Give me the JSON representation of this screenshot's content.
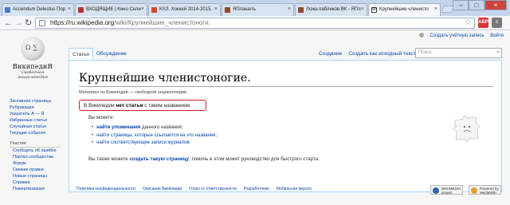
{
  "browser": {
    "tabs": [
      {
        "title": "Accendum Delectus Пор",
        "color": "#4a7cc7"
      },
      {
        "title": "ВХОДЯЩИЕ | Кино Сели",
        "color": "#b83333"
      },
      {
        "title": "КХЛ. Хоккей 2014-2015. ",
        "color": "#d44a2a"
      },
      {
        "title": "ЯПлакалъ",
        "color": "#8e4a2a"
      },
      {
        "title": "Ложа пабликов ВК - ЯПл",
        "color": "#8e4a2a"
      },
      {
        "title": "Крупнейшие членисто",
        "color": "#333333",
        "active": true
      }
    ],
    "tab_close": "×",
    "window_buttons": [
      "–",
      "□",
      "×"
    ],
    "url_host": "https://ru.wikipedia.org",
    "url_rest": "/wiki/Крупнейшие_членистоноги.",
    "nav": {
      "back": "←",
      "forward": "→",
      "reload": "↻"
    },
    "star": "☆"
  },
  "wiki": {
    "personal": {
      "create_account": "Создать учётную запись",
      "login": "Войти"
    },
    "logo": {
      "title": "ВикипедиЯ",
      "subtitle": "Свободная энциклопедия"
    },
    "sidebar": {
      "main": [
        "Заглавная страница",
        "Рубрикация",
        "Указатель А — Я",
        "Избранные статьи",
        "Случайная статья",
        "Текущие события"
      ],
      "participation_heading": "Участие",
      "participation": [
        "Сообщить об ошибке",
        "Портал сообщества",
        "Форум",
        "Свежие правки",
        "Новые страницы",
        "Справка",
        "Пожертвования"
      ]
    },
    "tabs": {
      "article": "Статья",
      "discussion": "Обсуждение",
      "create": "Создание",
      "create_source": "Создать как исходный текст"
    },
    "search_placeholder": "Поиск",
    "heading": "Крупнейшие членистоногие.",
    "tagline": "Материал из Википедии — свободной энциклопедии",
    "notice": {
      "pre": "В Википедии ",
      "bold": "нет статьи",
      "post": " с таким названием."
    },
    "you_can": "Вы можете:",
    "bullets": [
      {
        "link": "найти упоминания",
        "rest": " данного названия;"
      },
      {
        "link": "найти страницы, которые ссылаются на это название",
        "rest": ";"
      },
      {
        "link": "найти соответствующие записи журналов",
        "rest": "."
      }
    ],
    "create": {
      "pre": "Вы также можете ",
      "link": "создать такую страницу",
      "post": ", помочь в этом может руководство для быстрого старта."
    },
    "footer": [
      "Политика конфиденциальности",
      "Описание Википедии",
      "Отказ от ответственности",
      "Разработчики",
      "Мобильная версия"
    ],
    "badges": [
      {
        "line1": "WIKIMEDIA",
        "line2": "project"
      },
      {
        "line1": "Powered by",
        "line2": "MediaWiki"
      }
    ]
  }
}
